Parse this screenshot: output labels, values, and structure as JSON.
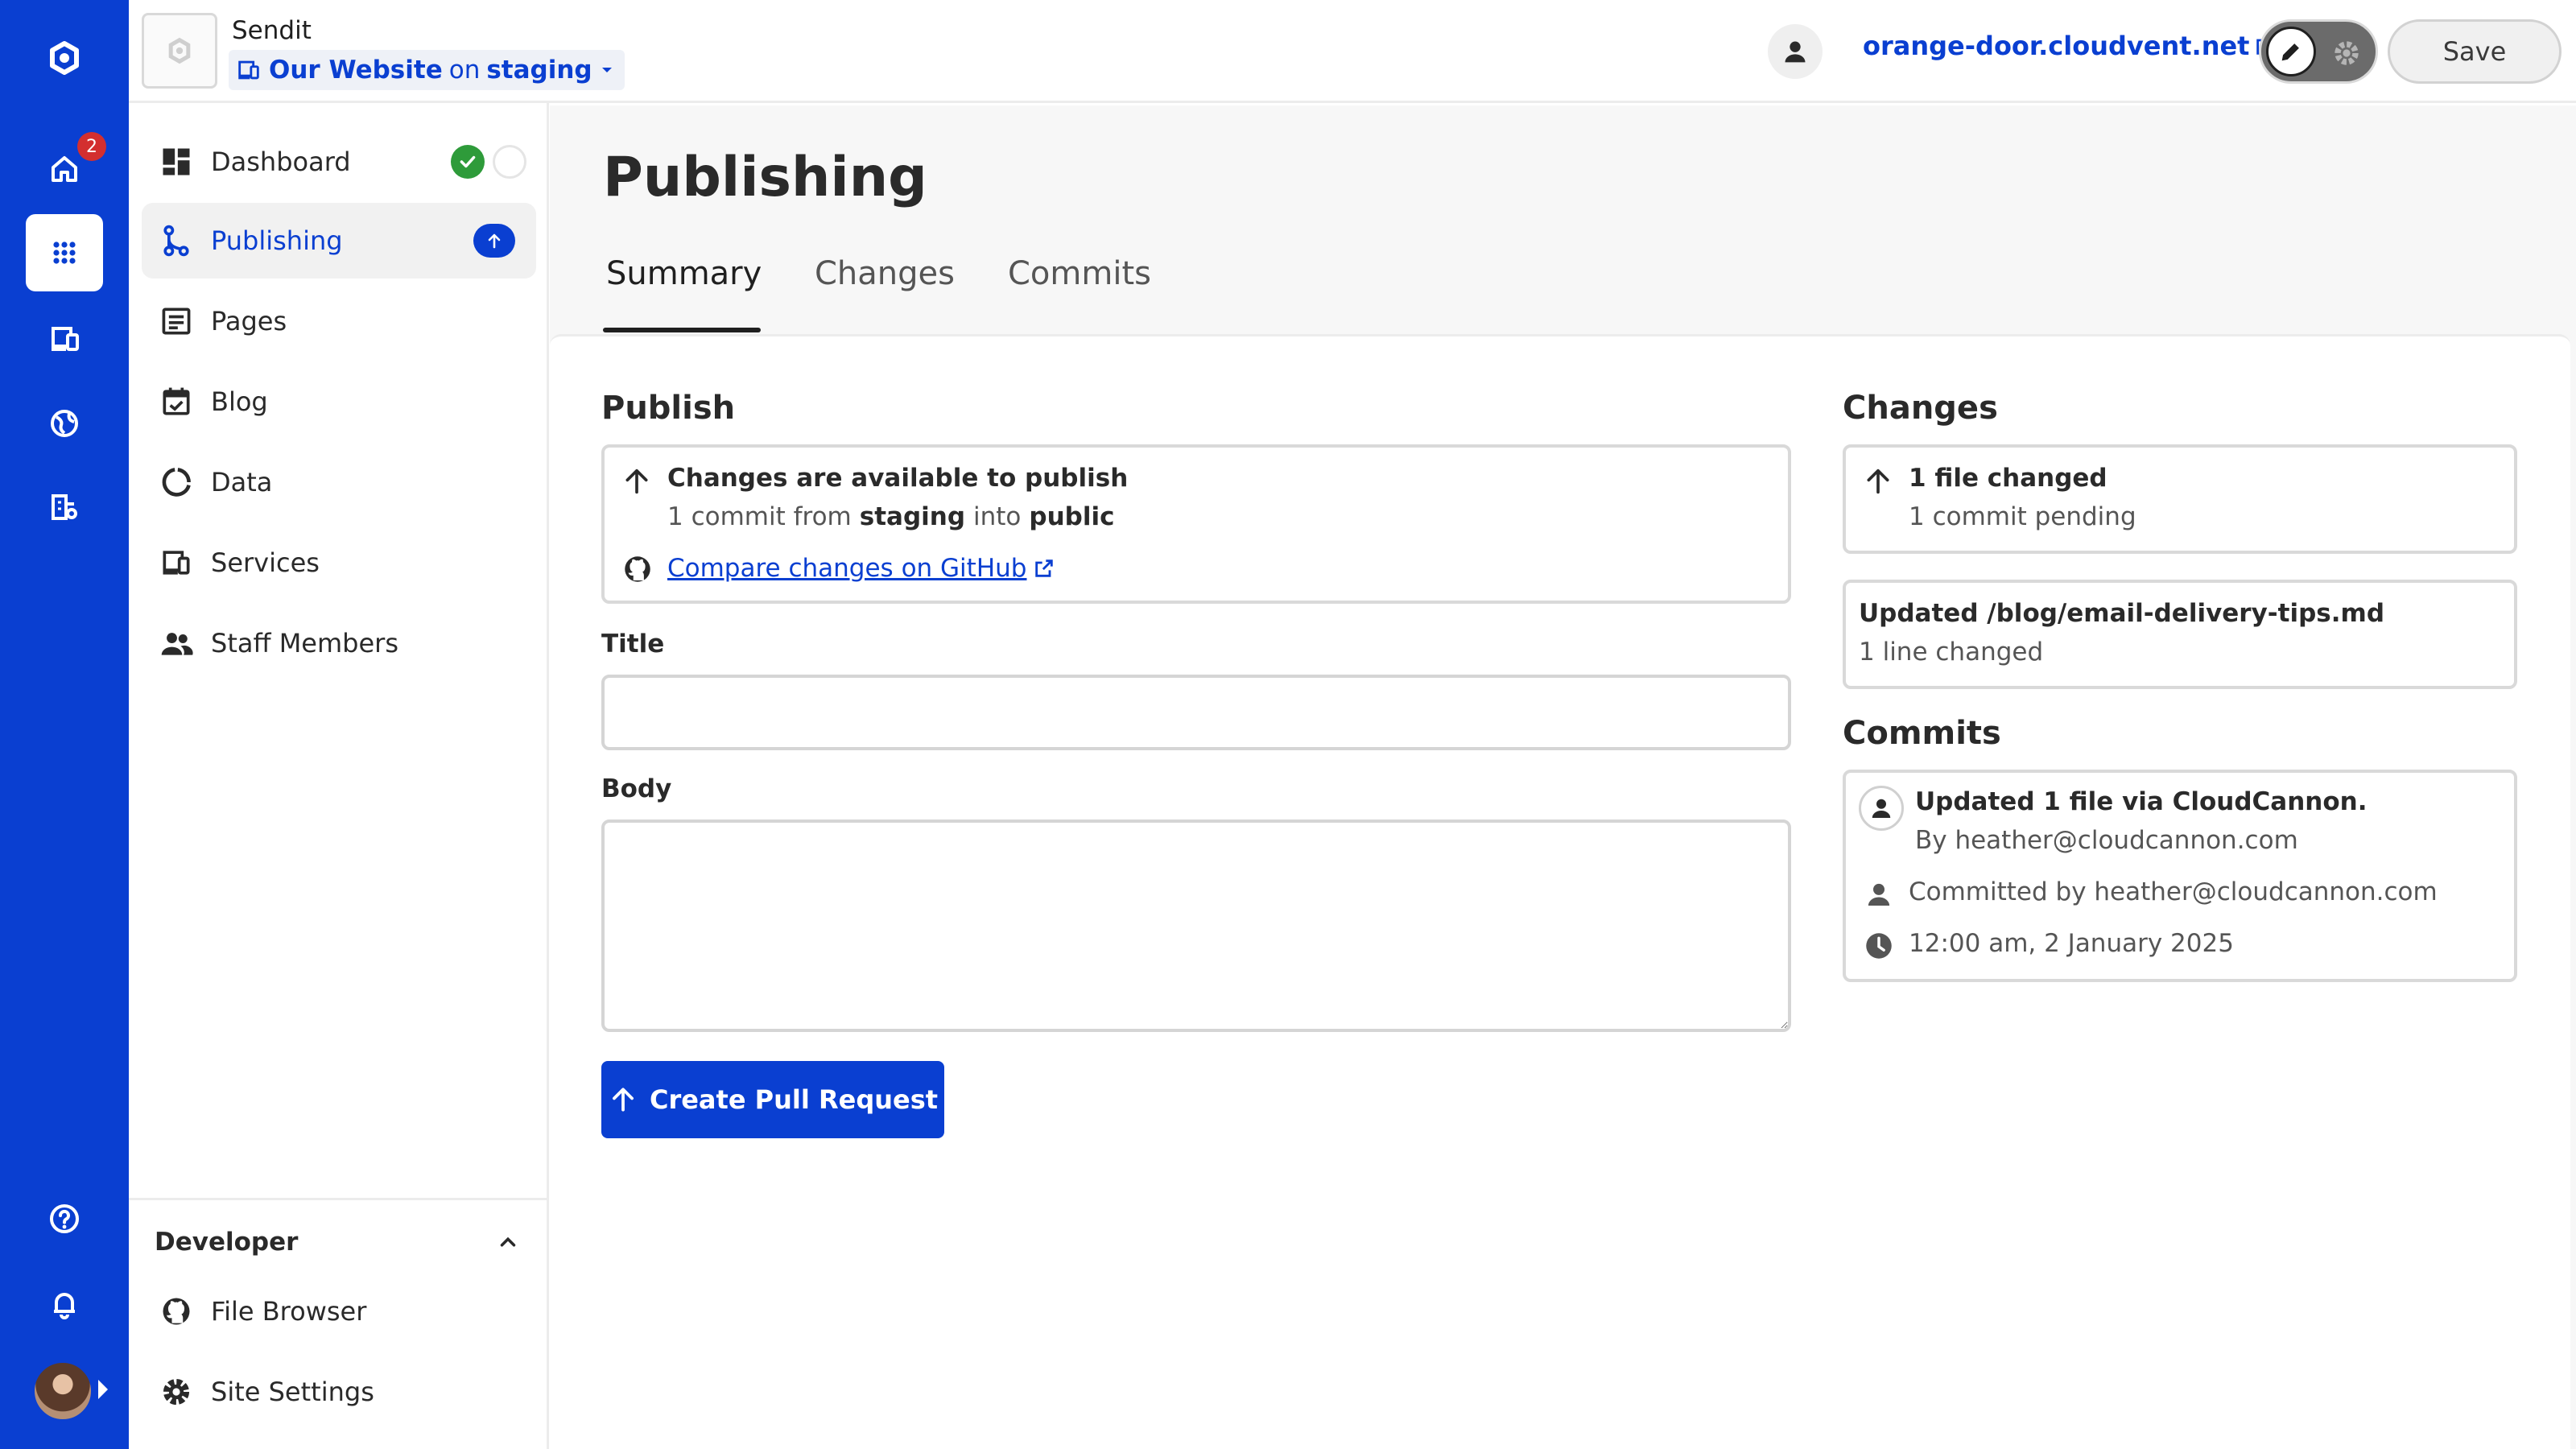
{
  "header": {
    "org_name": "Sendit",
    "site_name": "Our Website",
    "site_on": "on",
    "branch": "staging",
    "domain": "orange-door.cloudvent.net",
    "save_label": "Save"
  },
  "rail": {
    "notification_count": "2"
  },
  "sidebar": {
    "items": [
      {
        "label": "Dashboard"
      },
      {
        "label": "Publishing"
      },
      {
        "label": "Pages"
      },
      {
        "label": "Blog"
      },
      {
        "label": "Data"
      },
      {
        "label": "Services"
      },
      {
        "label": "Staff Members"
      }
    ],
    "developer": {
      "title": "Developer",
      "items": [
        {
          "label": "File Browser"
        },
        {
          "label": "Site Settings"
        }
      ]
    }
  },
  "main": {
    "title": "Publishing",
    "tabs": [
      {
        "label": "Summary"
      },
      {
        "label": "Changes"
      },
      {
        "label": "Commits"
      }
    ],
    "publish": {
      "heading": "Publish",
      "status": "Changes are available to publish",
      "detail_prefix": "1 commit from",
      "source_branch": "staging",
      "detail_mid": "into",
      "target_branch": "public",
      "compare_link": "Compare changes on GitHub"
    },
    "form": {
      "title_label": "Title",
      "title_value": "",
      "body_label": "Body",
      "body_value": "",
      "submit_label": "Create Pull Request"
    },
    "changes": {
      "heading": "Changes",
      "summary_title": "1 file changed",
      "summary_sub": "1 commit pending",
      "file_title": "Updated /blog/email-delivery-tips.md",
      "file_sub": "1 line changed"
    },
    "commits": {
      "heading": "Commits",
      "message": "Updated 1 file via CloudCannon.",
      "author": "By heather@cloudcannon.com",
      "committer": "Committed by heather@cloudcannon.com",
      "time": "12:00 am, 2 January 2025"
    }
  },
  "colors": {
    "brand": "#0a3fd1",
    "success": "#2e9b3a",
    "badge": "#d32f2f"
  }
}
